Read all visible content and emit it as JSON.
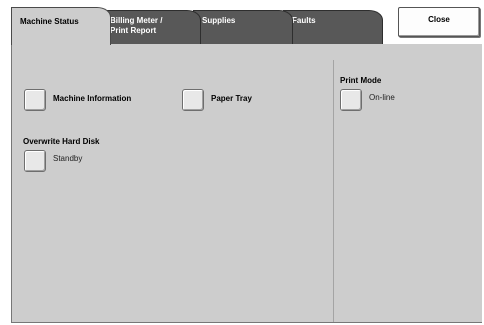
{
  "tabs": [
    {
      "label": "Machine Status",
      "active": true
    },
    {
      "label": "Billing Meter / Print Report",
      "line1": "Billing Meter /",
      "line2": "Print Report",
      "active": false
    },
    {
      "label": "Supplies",
      "active": false
    },
    {
      "label": "Faults",
      "active": false
    }
  ],
  "close_label": "Close",
  "items": {
    "machine_information": "Machine Information",
    "paper_tray": "Paper Tray",
    "overwrite_hard_disk": {
      "title": "Overwrite Hard Disk",
      "status": "Standby"
    },
    "print_mode": {
      "title": "Print Mode",
      "status": "On-line"
    }
  },
  "colors": {
    "panel": "#cdcdcd",
    "inactive_tab": "#585858",
    "button_face": "#e8e8e8"
  }
}
